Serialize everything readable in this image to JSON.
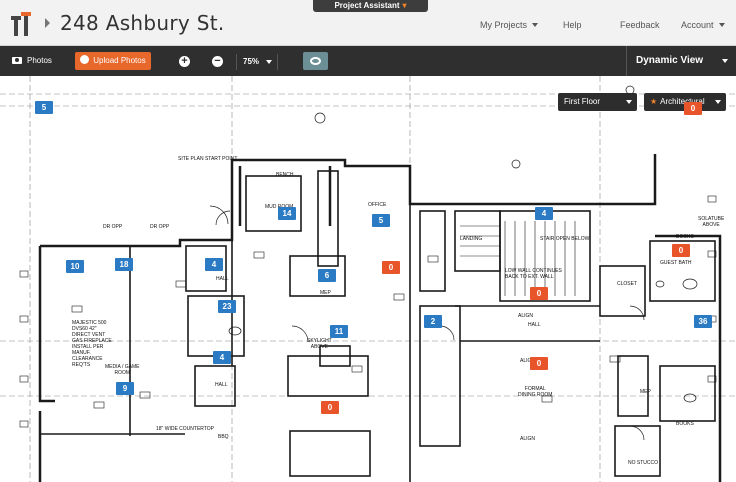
{
  "header": {
    "project_title": "248 Ashbury St.",
    "assistant_label": "Project Assistant",
    "nav": [
      "My Projects",
      "Help",
      "Feedback",
      "Account"
    ]
  },
  "toolbar": {
    "photos_label": "Photos",
    "upload_label": "Upload Photos",
    "zoom_in": "+",
    "zoom_out": "−",
    "zoom_value": "75%",
    "view_label": "Dynamic View"
  },
  "plan": {
    "floor_select": "First Floor",
    "layer_select": "Architectural",
    "room_labels": {
      "mud_room": "MUD ROOM",
      "office": "OFFICE",
      "hall_a": "HALL",
      "hall_b": "HALL",
      "hall_c": "HALL",
      "mep": "MEP",
      "mep2": "MEP",
      "media": "MEDIA / GAME\nROOM",
      "formal": "FORMAL\nDINING ROOM",
      "guest_bath": "GUEST BATH",
      "closet": "CLOSET",
      "landing": "LANDING",
      "skylight": "SKYLIGHT\nABOVE",
      "stair": "STAIR OPEN BELOW",
      "bench": "BENCH",
      "site_plan": "SITE PLAN START POINT",
      "countertop": "18\" WIDE COUNTERTOP",
      "books": "BOOKS",
      "books2": "BOOKS",
      "align1": "ALIGN",
      "align2": "ALIGN",
      "align3": "ALIGN",
      "fireplace": "MAJESTIC 500\nDVS60 42\"\nDIRECT VENT\nGAS FIREPLACE\nINSTALL PER\nMANUF.\nCLEARANCE\nREQ'TS",
      "low_wall": "LOW WALL CONTINUES\nBACK TO EXT. WALL",
      "dr_opp": "DR OPP",
      "dr_opp2": "DR OPP",
      "bbq": "BBQ",
      "no_stucco": "NO STUCCO",
      "solatube": "SOLATUBE\nABOVE"
    },
    "blue_pins": [
      "5",
      "14",
      "5",
      "4",
      "10",
      "18",
      "4",
      "6",
      "23",
      "2",
      "11",
      "4",
      "9",
      "36"
    ],
    "orange_pins": [
      "0",
      "0",
      "0",
      "0",
      "0",
      "0"
    ]
  },
  "colors": {
    "accent_orange": "#e8672a",
    "pin_blue": "#2a7ac4",
    "pin_orange": "#e8552a",
    "toolbar_bg": "#2f2f2f"
  }
}
